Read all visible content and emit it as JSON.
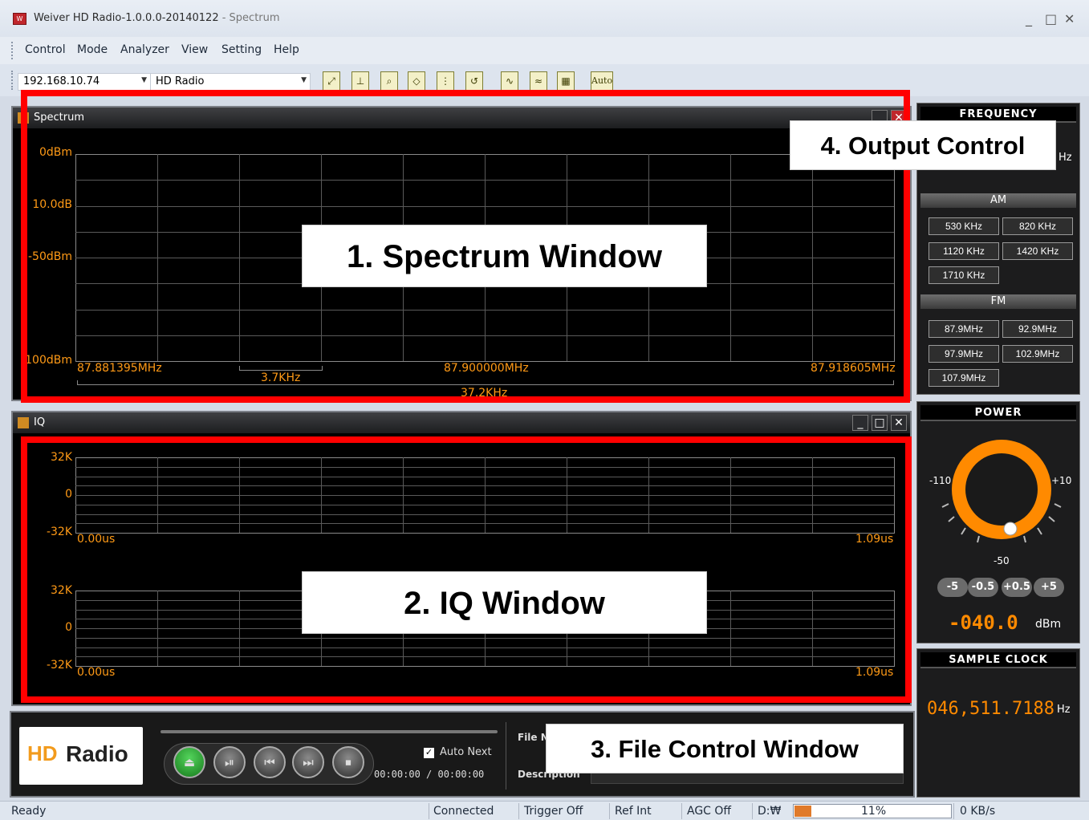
{
  "window": {
    "title": "Weiver HD Radio-1.0.0.0-20140122",
    "subtitle": "- Spectrum",
    "app_icon_text": "W",
    "minimize": "_",
    "maximize": "□",
    "close": "✕"
  },
  "menu": [
    "Control",
    "Mode",
    "Analyzer",
    "View",
    "Setting",
    "Help"
  ],
  "toolbar": {
    "ip": "192.168.10.74",
    "mode": "HD Radio",
    "auto_label": "Auto",
    "icons": [
      "zoom-xy-icon",
      "zoom-x-icon",
      "magnifier-icon",
      "marker-icon",
      "bars-icon",
      "undo-icon",
      "spectrum-icon",
      "waterfall-icon",
      "grid-icon"
    ]
  },
  "spectrum": {
    "title": "Spectrum",
    "ylabels": [
      "0dBm",
      "10.0dB",
      "-50dBm",
      "100dBm"
    ],
    "freq_start": "87.881395MHz",
    "freq_center": "87.900000MHz",
    "freq_end": "87.918605MHz",
    "rbw": "3.7KHz",
    "span": "37.2KHz"
  },
  "iq": {
    "title": "IQ",
    "plot1_ylabels": [
      "32K",
      "0",
      "-32K"
    ],
    "plot2_ylabels": [
      "32K",
      "0",
      "-32K"
    ],
    "t_start": "0.00us",
    "t_end": "1.09us"
  },
  "callouts": {
    "spectrum": "1. Spectrum Window",
    "iq": "2. IQ Window",
    "file": "3. File Control Window",
    "output": "4. Output Control"
  },
  "frequency": {
    "header": "FREQUENCY",
    "unit_partial": "Hz",
    "am_label": "AM",
    "am": [
      "530 KHz",
      "820 KHz",
      "1120 KHz",
      "1420 KHz",
      "1710 KHz"
    ],
    "fm_label": "FM",
    "fm": [
      "87.9MHz",
      "92.9MHz",
      "97.9MHz",
      "102.9MHz",
      "107.9MHz"
    ]
  },
  "power": {
    "header": "POWER",
    "min": "-110",
    "max": "+10",
    "mid": "-50",
    "steps": [
      "-5",
      "-0.5",
      "+0.5",
      "+5"
    ],
    "value": "-040.0",
    "unit": "dBm"
  },
  "sample_clock": {
    "header": "SAMPLE CLOCK",
    "value": "046,511.7188",
    "unit": "Hz"
  },
  "file_control": {
    "logo_text": "Radio",
    "logo_mark": "HD",
    "auto_next": "Auto Next",
    "time": "00:00:00 / 00:00:00",
    "file_label": "File N",
    "description_label": "Description"
  },
  "status": {
    "ready": "Ready",
    "connected": "Connected",
    "trigger": "Trigger Off",
    "ref": "Ref Int",
    "agc": "AGC Off",
    "drive": "D:₩",
    "progress_text": "11%",
    "progress": 0.11,
    "rate": "0 KB/s"
  },
  "colors": {
    "trace": "#ff9a16",
    "highlight": "#ff0000",
    "knob": "#ff8a00"
  }
}
